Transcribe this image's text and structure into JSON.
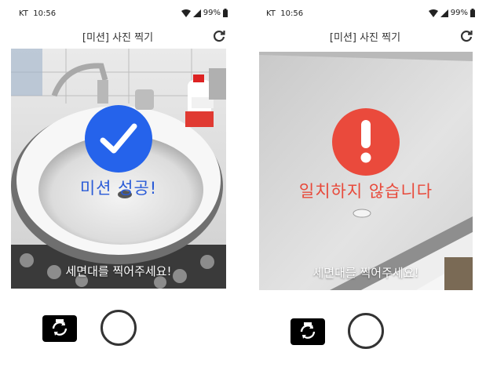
{
  "screens": [
    {
      "status": {
        "carrier": "KT",
        "time": "10:56",
        "battery": "99%"
      },
      "header": {
        "title": "[미션] 사진 찍기",
        "refresh_icon": "refresh-icon"
      },
      "result": {
        "state": "success",
        "icon": "check-icon",
        "text": "미션 성공!",
        "color": "#2563eb"
      },
      "instruction": "세면대를 찍어주세요!",
      "controls": {
        "switch_camera_icon": "switch-camera-icon",
        "shutter": "shutter-button"
      }
    },
    {
      "status": {
        "carrier": "KT",
        "time": "10:56",
        "battery": "99%"
      },
      "header": {
        "title": "[미션] 사진 찍기",
        "refresh_icon": "refresh-icon"
      },
      "result": {
        "state": "mismatch",
        "icon": "exclamation-icon",
        "text": "일치하지 않습니다",
        "color": "#ea4a3c"
      },
      "instruction": "세면대를 찍어주세요!",
      "controls": {
        "switch_camera_icon": "switch-camera-icon",
        "shutter": "shutter-button"
      }
    }
  ]
}
